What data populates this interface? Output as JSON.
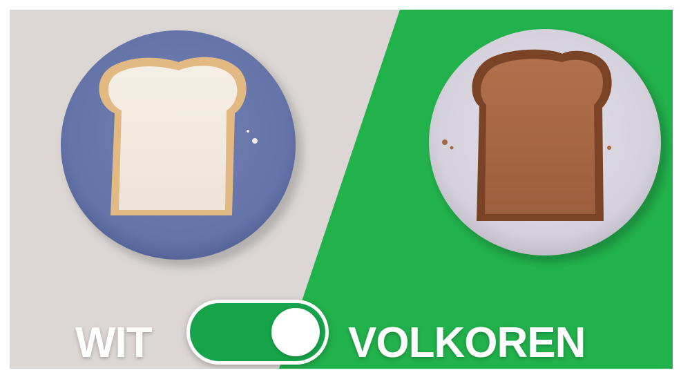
{
  "toggle": {
    "left_label": "WIT",
    "right_label": "VOLKOREN",
    "state": "on",
    "track_color": "#16a34a"
  },
  "scene": {
    "left_background": "#dcd7d5",
    "right_background": "#22b24c",
    "left_plate_color": "#6b7aad",
    "right_plate_color": "#d8d6de",
    "left_bread": "white-bread-slice",
    "right_bread": "whole-wheat-bread-slice"
  }
}
